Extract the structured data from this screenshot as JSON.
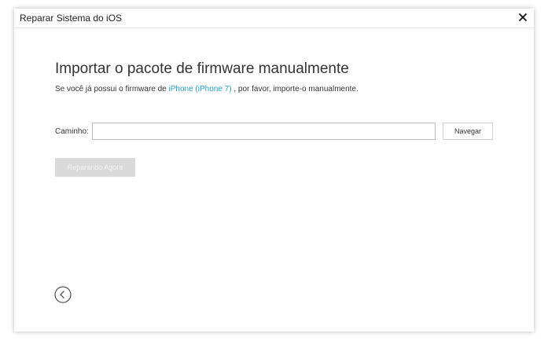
{
  "window": {
    "title": "Reparar Sistema do iOS"
  },
  "main": {
    "heading": "Importar o pacote de firmware manualmente",
    "subtitle_before": "Se você já possui o firmware de ",
    "subtitle_link": "iPhone (iPhone 7)",
    "subtitle_after": " , por favor, importe-o manualmente.",
    "path_label": "Caminho:",
    "path_value": "",
    "browse_label": "Navegar",
    "repair_label": "Reparando Agora"
  },
  "icons": {
    "close": "close-icon",
    "back": "back-arrow-icon"
  },
  "colors": {
    "link": "#1ba3c6",
    "disabled_button": "#d9d9d9"
  }
}
